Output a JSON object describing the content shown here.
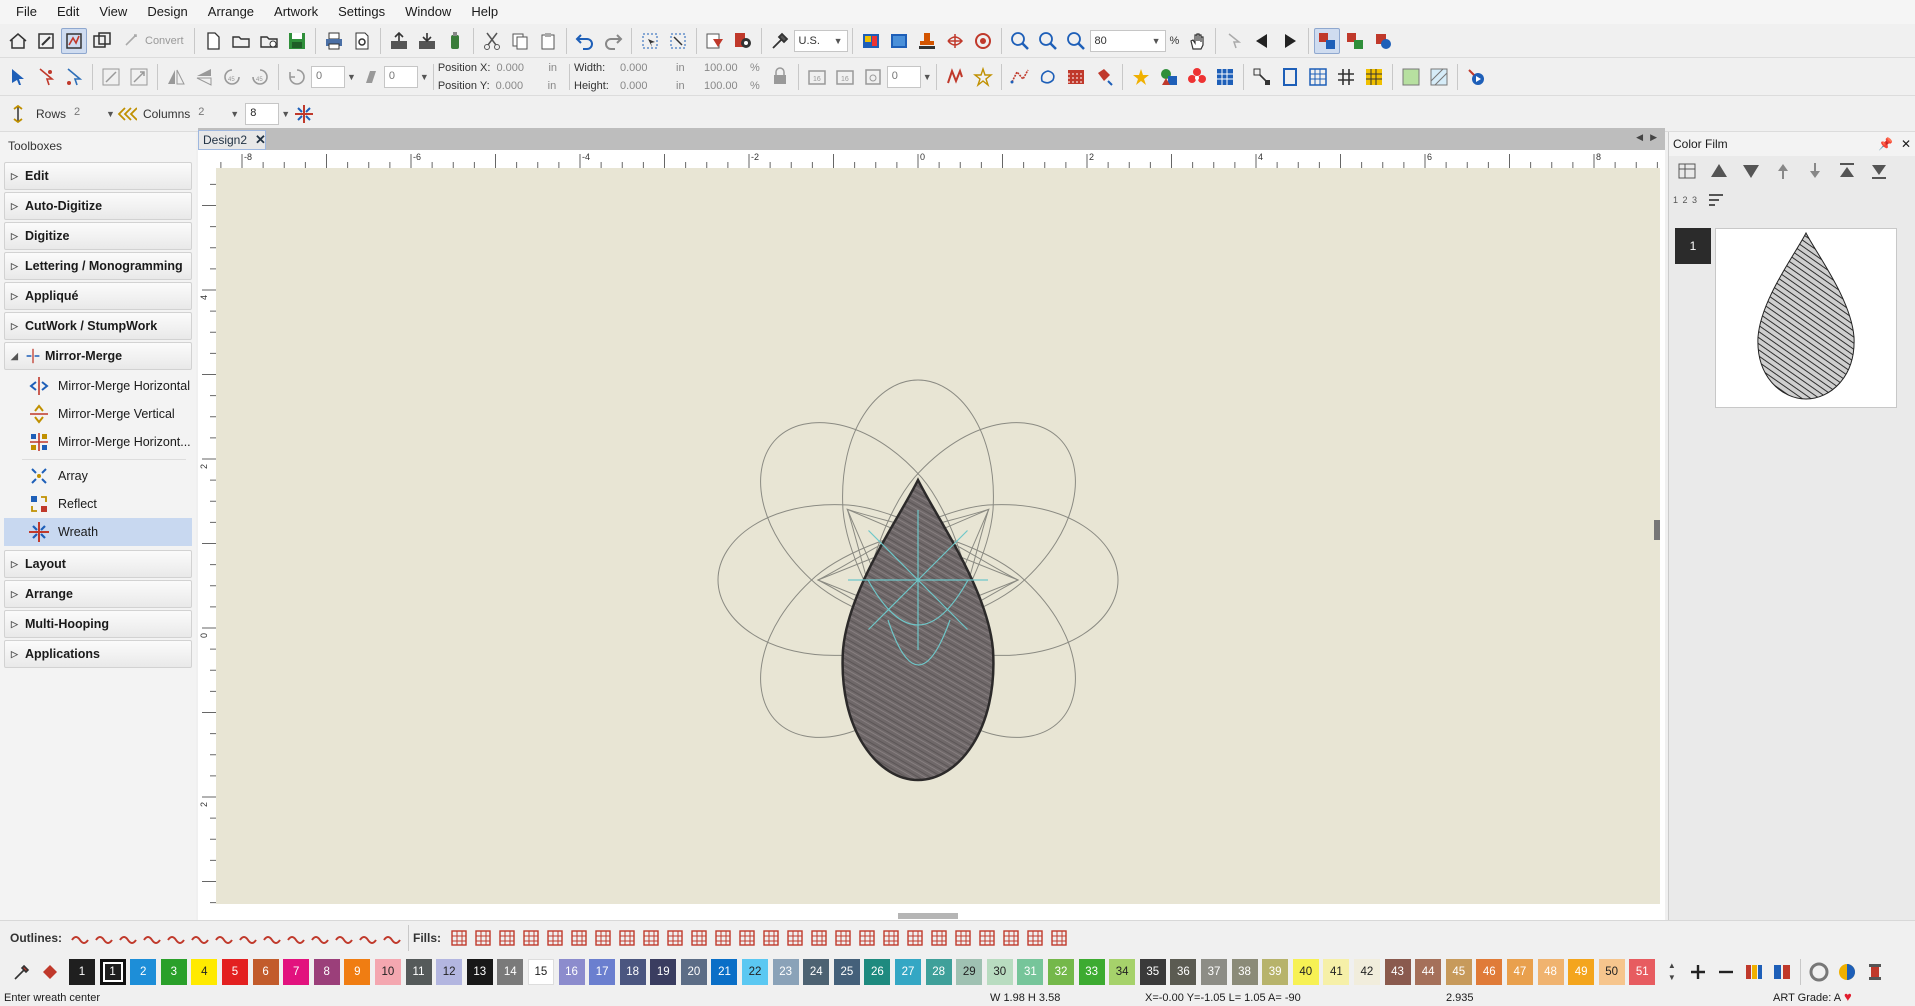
{
  "menu": [
    "File",
    "Edit",
    "View",
    "Design",
    "Arrange",
    "Artwork",
    "Settings",
    "Window",
    "Help"
  ],
  "toolbar": {
    "convert_label": "Convert",
    "units_value": "U.S.",
    "zoom_value": "80",
    "zoom_unit": "%"
  },
  "position": {
    "x_label": "Position X:",
    "x_value": "0.000",
    "y_label": "Position Y:",
    "y_value": "0.000",
    "unit": "in"
  },
  "size": {
    "width_label": "Width:",
    "width_value": "0.000",
    "height_label": "Height:",
    "height_value": "0.000",
    "unit": "in",
    "width_pct": "100.00",
    "height_pct": "100.00",
    "pct": "%"
  },
  "rotate_value": "0",
  "slant_value": "0",
  "angle_value": "0",
  "grid": {
    "rows_label": "Rows",
    "rows_value": "2",
    "columns_label": "Columns",
    "columns_value": "2",
    "count_value": "8"
  },
  "toolboxes": {
    "title": "Toolboxes",
    "groups_top": [
      "Edit",
      "Auto-Digitize",
      "Digitize",
      "Lettering / Monogramming",
      "Appliqué",
      "CutWork / StumpWork"
    ],
    "expanded": "Mirror-Merge",
    "items": [
      "Mirror-Merge Horizontal",
      "Mirror-Merge Vertical",
      "Mirror-Merge Horizont..."
    ],
    "items2": [
      "Array",
      "Reflect",
      "Wreath"
    ],
    "groups_bottom": [
      "Layout",
      "Arrange",
      "Multi-Hooping",
      "Applications"
    ]
  },
  "doc": {
    "tab": "Design2"
  },
  "ruler": {
    "h": [
      "-8",
      "-6",
      "-4",
      "-2",
      "0",
      "2",
      "4",
      "6",
      "8"
    ],
    "v": [
      "4",
      "2",
      "0",
      "2"
    ]
  },
  "colorfilm": {
    "title": "Color Film",
    "step": "1",
    "numbers": "1 2 3"
  },
  "outlines_label": "Outlines:",
  "fills_label": "Fills:",
  "palette": [
    {
      "n": "1",
      "c": "#1f1f1f"
    },
    {
      "n": "2",
      "c": "#1d8ed8"
    },
    {
      "n": "3",
      "c": "#2aa02a"
    },
    {
      "n": "4",
      "c": "#ffea00"
    },
    {
      "n": "5",
      "c": "#e32020"
    },
    {
      "n": "6",
      "c": "#c25b2b"
    },
    {
      "n": "7",
      "c": "#e2127e"
    },
    {
      "n": "8",
      "c": "#9b3f7a"
    },
    {
      "n": "9",
      "c": "#f07d12"
    },
    {
      "n": "10",
      "c": "#f4a7b0"
    },
    {
      "n": "11",
      "c": "#555a5a"
    },
    {
      "n": "12",
      "c": "#b3b6e0"
    },
    {
      "n": "13",
      "c": "#181818"
    },
    {
      "n": "14",
      "c": "#7a7a7a"
    },
    {
      "n": "15",
      "c": "#ffffff"
    },
    {
      "n": "16",
      "c": "#8c8ccd"
    },
    {
      "n": "17",
      "c": "#6b7fcf"
    },
    {
      "n": "18",
      "c": "#4b5680"
    },
    {
      "n": "19",
      "c": "#3a3d60"
    },
    {
      "n": "20",
      "c": "#5c6d86"
    },
    {
      "n": "21",
      "c": "#0a6fc7"
    },
    {
      "n": "22",
      "c": "#5bc8f2"
    },
    {
      "n": "23",
      "c": "#8aa2b8"
    },
    {
      "n": "24",
      "c": "#4d6272"
    },
    {
      "n": "25",
      "c": "#44607a"
    },
    {
      "n": "26",
      "c": "#1e8a7f"
    },
    {
      "n": "27",
      "c": "#34a7c4"
    },
    {
      "n": "28",
      "c": "#3fa09a"
    },
    {
      "n": "29",
      "c": "#9fc1b2"
    },
    {
      "n": "30",
      "c": "#b8dcc0"
    },
    {
      "n": "31",
      "c": "#76c59a"
    },
    {
      "n": "32",
      "c": "#74b84a"
    },
    {
      "n": "33",
      "c": "#3dab31"
    },
    {
      "n": "34",
      "c": "#a6d26b"
    },
    {
      "n": "35",
      "c": "#3a3a3a"
    },
    {
      "n": "36",
      "c": "#5b5b52"
    },
    {
      "n": "37",
      "c": "#8d8d86"
    },
    {
      "n": "38",
      "c": "#8b8b78"
    },
    {
      "n": "39",
      "c": "#b7b36b"
    },
    {
      "n": "40",
      "c": "#f7f154"
    },
    {
      "n": "41",
      "c": "#f6f0a8"
    },
    {
      "n": "42",
      "c": "#f1eddc"
    },
    {
      "n": "43",
      "c": "#8a5a4e"
    },
    {
      "n": "44",
      "c": "#a5705a"
    },
    {
      "n": "45",
      "c": "#c79a5b"
    },
    {
      "n": "46",
      "c": "#e07b38"
    },
    {
      "n": "47",
      "c": "#e9a04d"
    },
    {
      "n": "48",
      "c": "#f0b36f"
    },
    {
      "n": "49",
      "c": "#f4a51d"
    },
    {
      "n": "50",
      "c": "#f6c58d"
    },
    {
      "n": "51",
      "c": "#e75c60"
    }
  ],
  "status": {
    "msg": "Enter wreath center",
    "dims": "W 1.98 H 3.58",
    "coords": "X=-0.00 Y=-1.05 L= 1.05 A= -90",
    "val": "2.935",
    "grade": "ART Grade: A"
  },
  "colors": {
    "canvas": "#e8e5d4",
    "accent": "#9eb7df",
    "fill": "#6f6869",
    "outline": "#8a8a82",
    "guides": "#6ec7c9"
  }
}
